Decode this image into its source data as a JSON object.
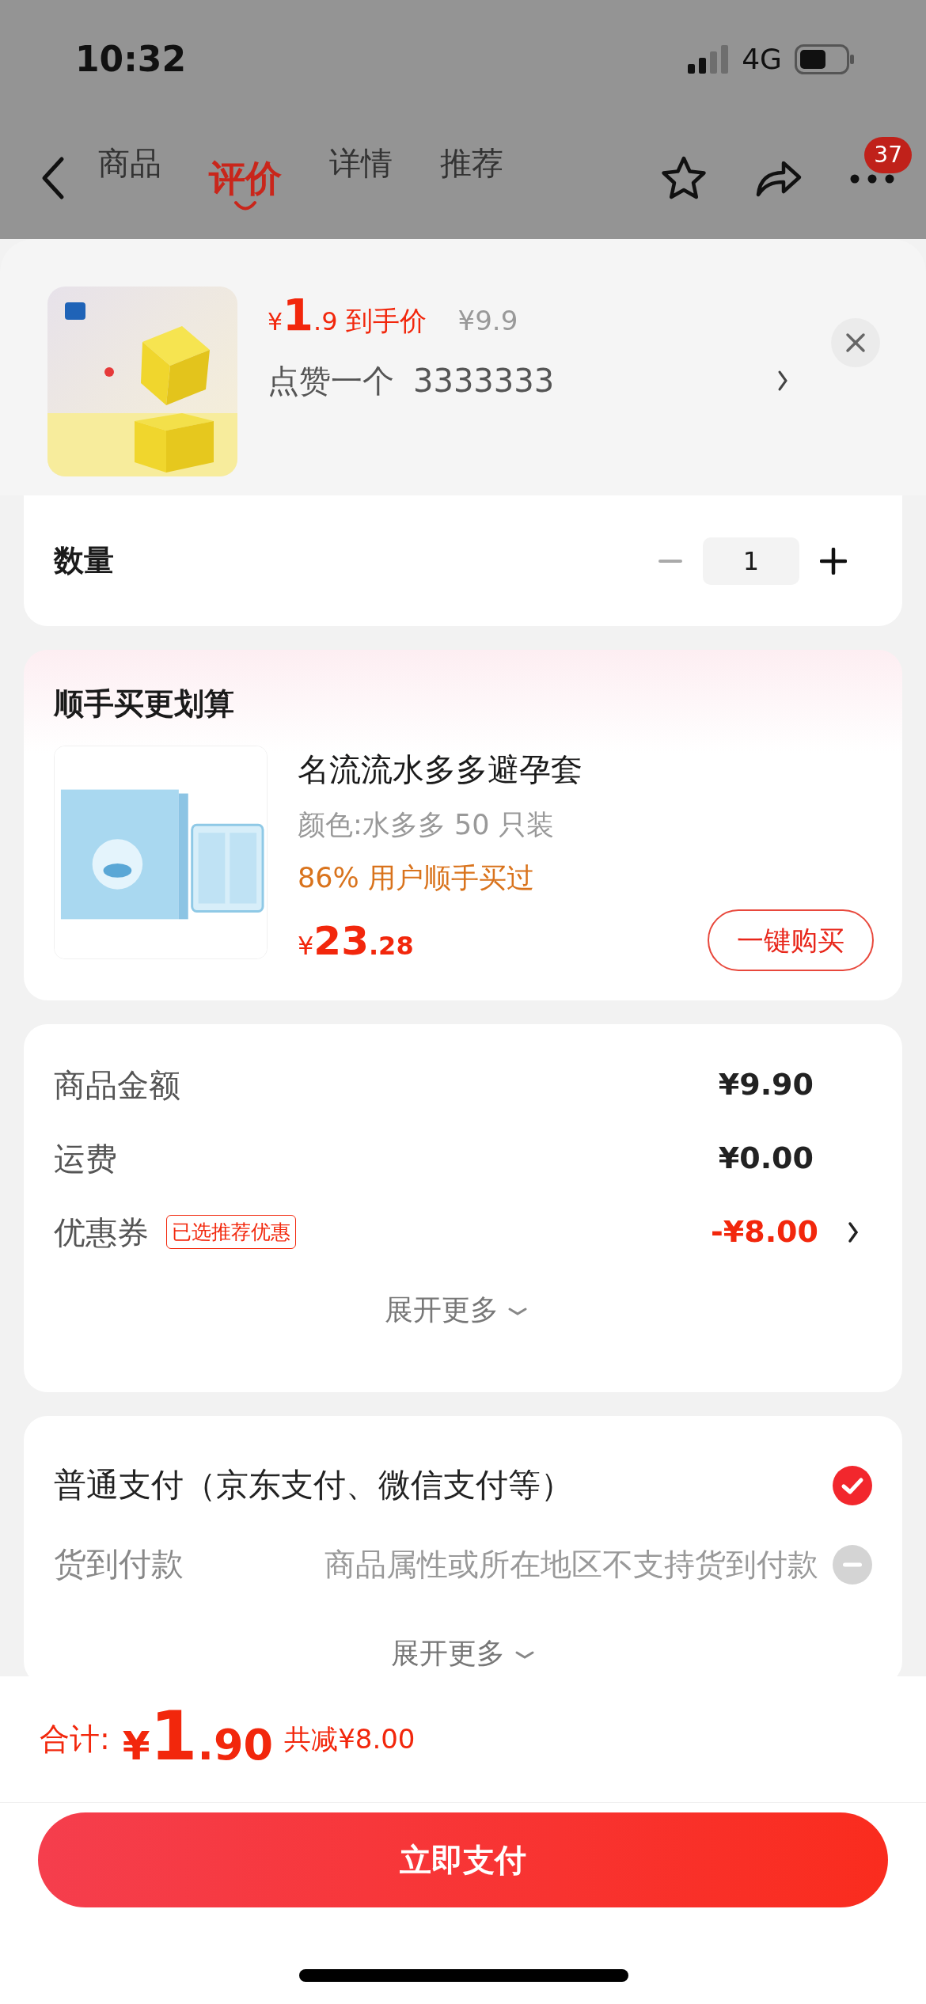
{
  "status_bar": {
    "time": "10:32",
    "network": "4G"
  },
  "nav": {
    "tabs": [
      {
        "label": "商品",
        "selected": false
      },
      {
        "label": "评价",
        "selected": true
      },
      {
        "label": "详情",
        "selected": false
      },
      {
        "label": "推荐",
        "selected": false
      }
    ],
    "badge": "37"
  },
  "product": {
    "price_symbol": "¥",
    "price_int": "1",
    "price_dec": ".9",
    "price_label": "到手价",
    "original_price": "¥9.9",
    "spec_name": "点赞一个",
    "spec_value": "3333333"
  },
  "quantity": {
    "label": "数量",
    "value": "1"
  },
  "bundle": {
    "title": "顺手买更划算",
    "name": "名流流水多多避孕套",
    "variant": "颜色:水多多 50 只装",
    "social_proof": "86% 用户顺手买过",
    "price_symbol": "¥",
    "price_int": "23",
    "price_dec": ".28",
    "button": "一键购买"
  },
  "summary": {
    "rows": [
      {
        "kind": "plain",
        "label": "商品金额",
        "value": "¥9.90"
      },
      {
        "kind": "plain",
        "label": "运费",
        "value": "¥0.00"
      },
      {
        "kind": "discount",
        "label": "优惠券",
        "tag": "已选推荐优惠",
        "value": "-¥8.00"
      }
    ],
    "expand": "展开更多"
  },
  "payment": {
    "options": [
      {
        "label": "普通支付（京东支付、微信支付等）",
        "selected": true,
        "disabled": false
      },
      {
        "label": "货到付款",
        "note": "商品属性或所在地区不支持货到付款",
        "selected": false,
        "disabled": true
      }
    ],
    "expand": "展开更多"
  },
  "footer": {
    "total_label": "合计:",
    "total_symbol": "¥",
    "total_int": "1",
    "total_dec": ".90",
    "saved": "共减¥8.00",
    "pay_button": "立即支付"
  }
}
